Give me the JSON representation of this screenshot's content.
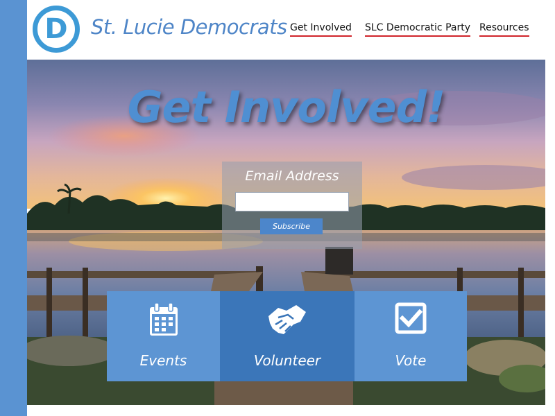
{
  "header": {
    "logo_letter": "D",
    "site_title": "St. Lucie Democrats",
    "nav": [
      {
        "label": "Get Involved"
      },
      {
        "label": "SLC Democratic Party"
      },
      {
        "label": "Resources"
      }
    ]
  },
  "hero": {
    "headline": "Get Involved!",
    "subscribe_form": {
      "label": "Email Address",
      "input_value": "",
      "button_label": "Subscribe"
    },
    "tiles": [
      {
        "label": "Events",
        "icon": "calendar-icon"
      },
      {
        "label": "Volunteer",
        "icon": "handshake-icon"
      },
      {
        "label": "Vote",
        "icon": "checkbox-icon"
      }
    ]
  },
  "colors": {
    "brand_blue": "#4e85c7",
    "logo_blue": "#3d9ad6",
    "nav_underline": "#d0232a",
    "tile_blue": "#5d95d3",
    "tile_blue_dark": "#3b76b9",
    "side_stripe": "#5a93d2"
  }
}
